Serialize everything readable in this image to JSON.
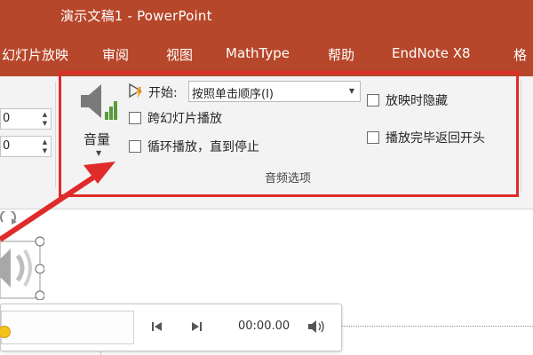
{
  "window": {
    "title": "演示文稿1 - PowerPoint"
  },
  "tabs": [
    "幻灯片放映",
    "审阅",
    "视图",
    "MathType",
    "帮助",
    "EndNote X8",
    "格"
  ],
  "ribbon": {
    "spinners": [
      "0",
      "0"
    ],
    "volume": {
      "label": "音量",
      "icon": "speaker-icon"
    },
    "start": {
      "label": "开始:",
      "value": "按照单击顺序(I)",
      "icon": "play-lightning-icon"
    },
    "checkboxes": [
      {
        "label": "跨幻灯片播放",
        "checked": false
      },
      {
        "label": "循环播放，直到停止",
        "checked": false
      },
      {
        "label": "放映时隐藏",
        "checked": false
      },
      {
        "label": "播放完毕返回开头",
        "checked": false
      }
    ],
    "group_label": "音频选项"
  },
  "player": {
    "time": "00:00.00",
    "progress": 0
  },
  "colors": {
    "accent": "#b7472a",
    "highlight": "#e02b2b",
    "knob": "#f4c21c"
  }
}
